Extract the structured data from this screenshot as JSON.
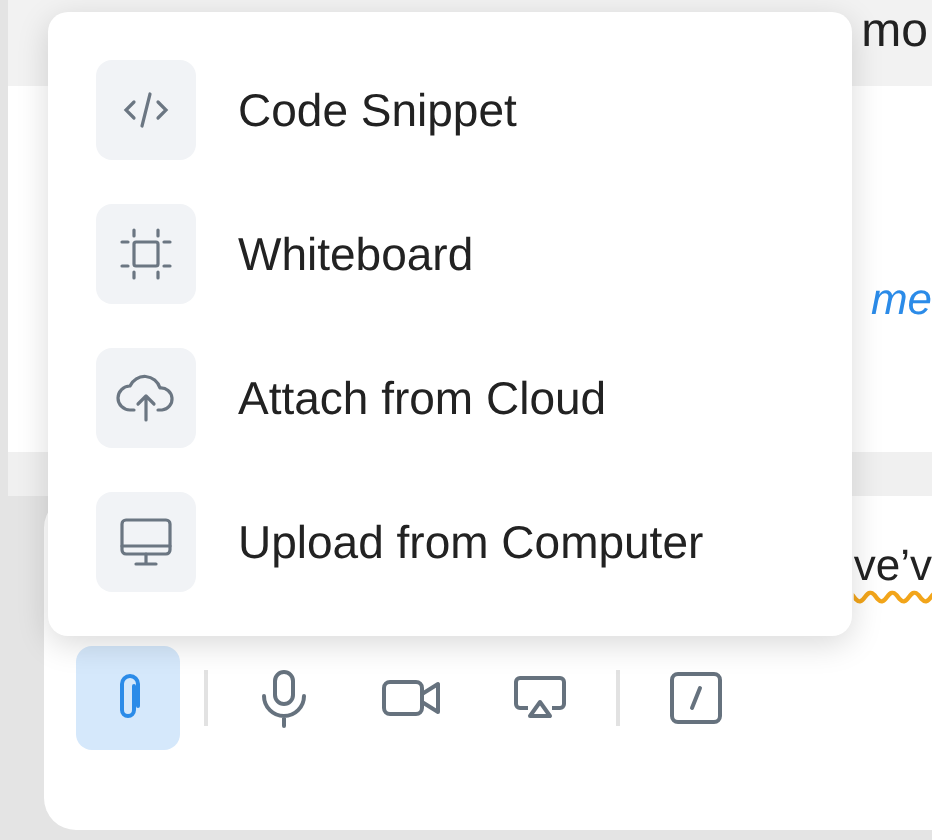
{
  "background": {
    "top_text": "mo",
    "link_text": "me",
    "draft_text": "ve’v"
  },
  "menu": {
    "items": [
      {
        "kind": "code",
        "label": "Code Snippet"
      },
      {
        "kind": "whiteboard",
        "label": "Whiteboard"
      },
      {
        "kind": "cloud",
        "label": "Attach from Cloud"
      },
      {
        "kind": "computer",
        "label": "Upload from Computer"
      }
    ]
  },
  "toolbar": [
    {
      "kind": "attach",
      "selected": true
    },
    {
      "kind": "divider"
    },
    {
      "kind": "mic",
      "selected": false
    },
    {
      "kind": "video",
      "selected": false
    },
    {
      "kind": "screen",
      "selected": false
    },
    {
      "kind": "divider"
    },
    {
      "kind": "slash",
      "selected": false
    }
  ]
}
